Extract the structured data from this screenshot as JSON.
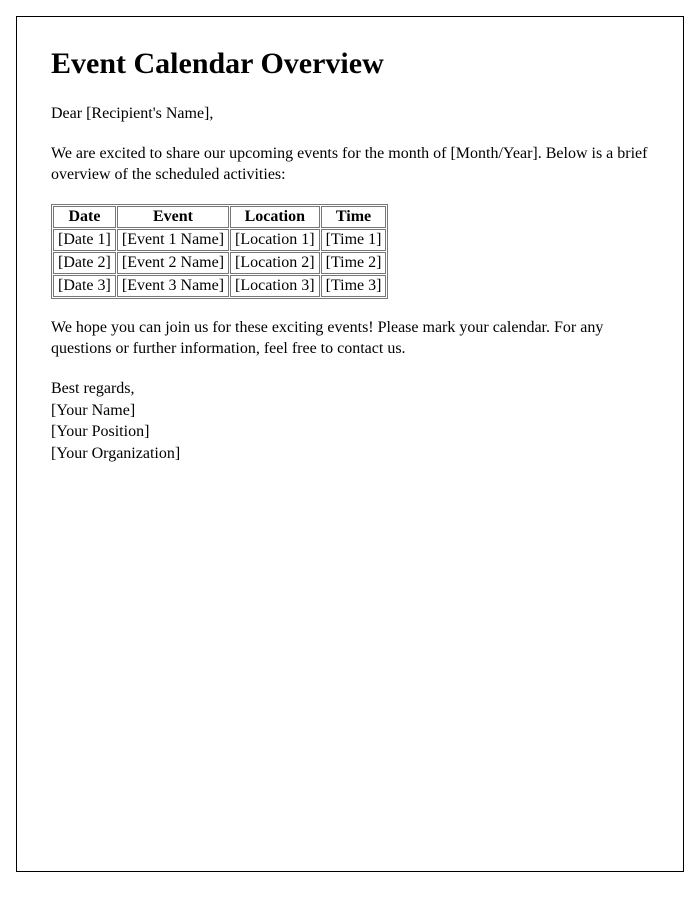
{
  "title": "Event Calendar Overview",
  "greeting": "Dear [Recipient's Name],",
  "intro": "We are excited to share our upcoming events for the month of [Month/Year]. Below is a brief overview of the scheduled activities:",
  "table": {
    "headers": [
      "Date",
      "Event",
      "Location",
      "Time"
    ],
    "rows": [
      [
        "[Date 1]",
        "[Event 1 Name]",
        "[Location 1]",
        "[Time 1]"
      ],
      [
        "[Date 2]",
        "[Event 2 Name]",
        "[Location 2]",
        "[Time 2]"
      ],
      [
        "[Date 3]",
        "[Event 3 Name]",
        "[Location 3]",
        "[Time 3]"
      ]
    ]
  },
  "outro": "We hope you can join us for these exciting events! Please mark your calendar. For any questions or further information, feel free to contact us.",
  "closing": {
    "salutation": "Best regards,",
    "name": "[Your Name]",
    "position": "[Your Position]",
    "organization": "[Your Organization]"
  }
}
